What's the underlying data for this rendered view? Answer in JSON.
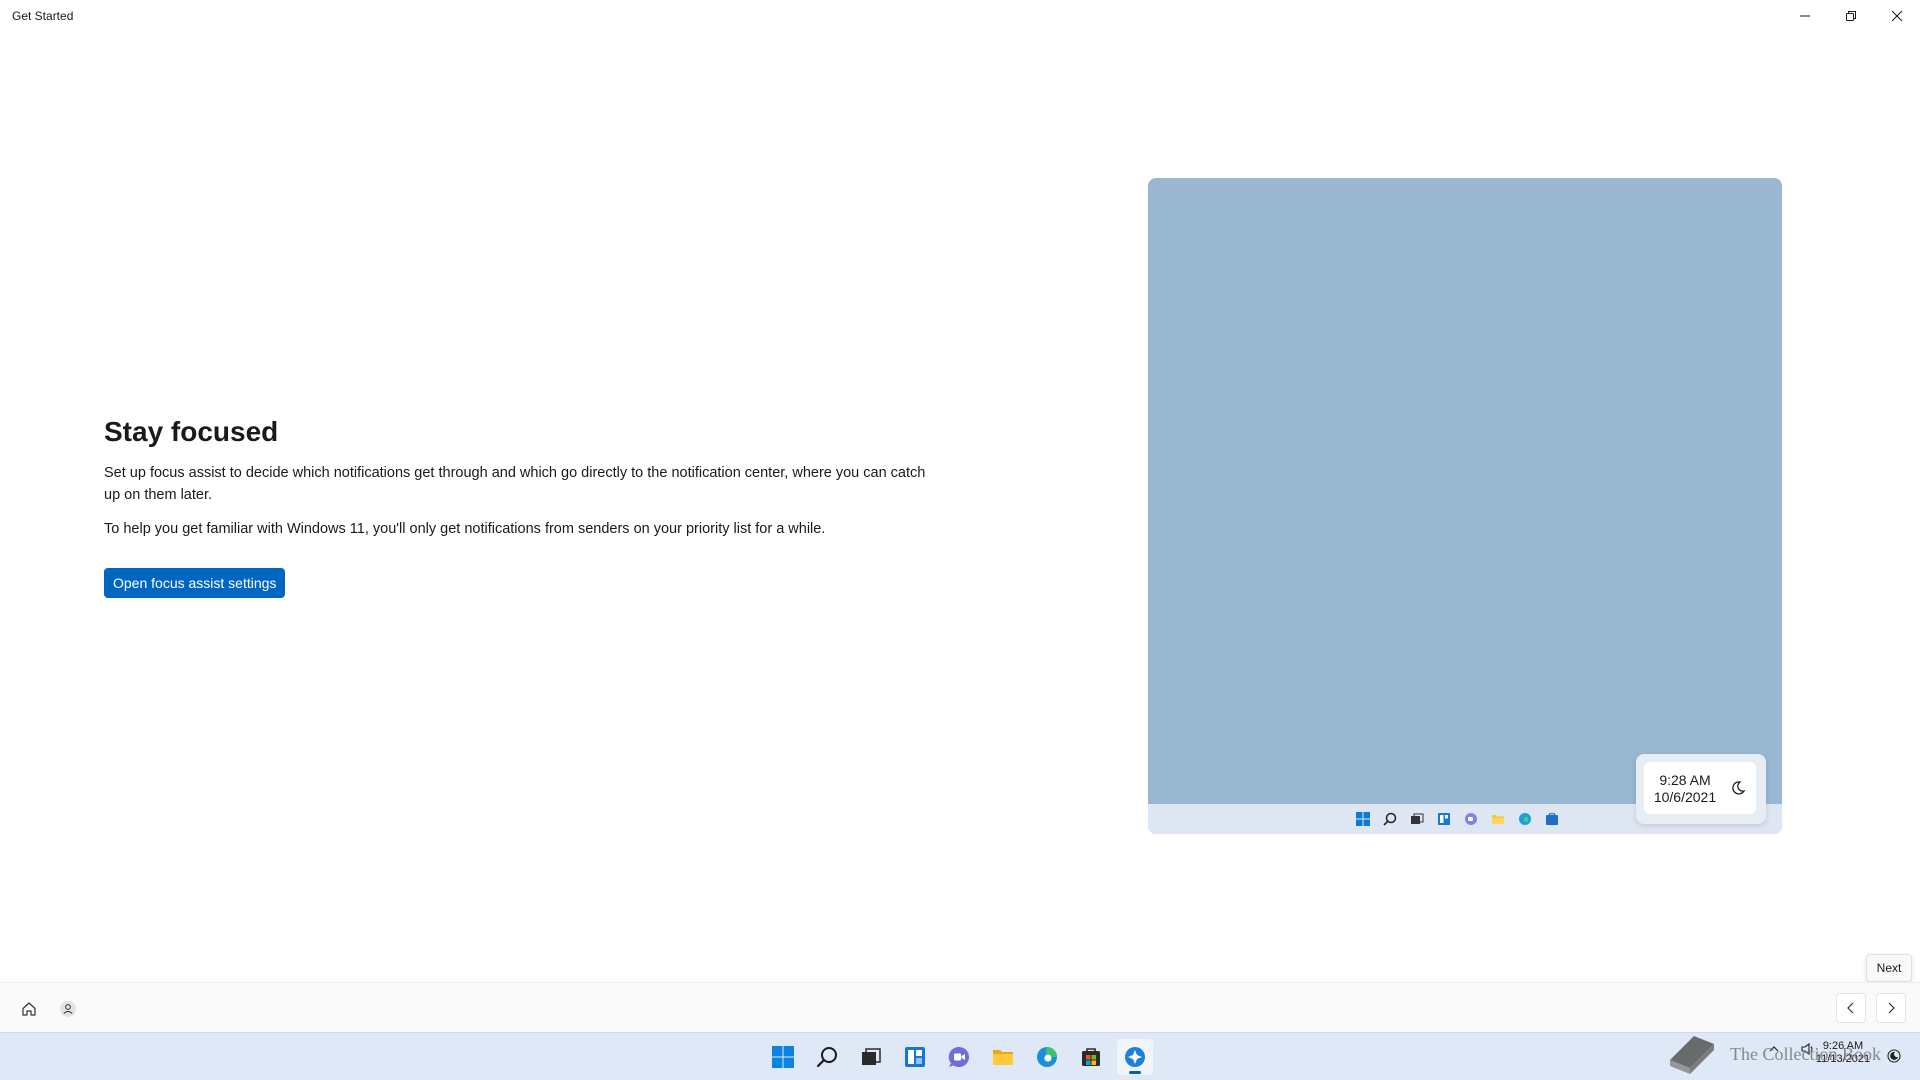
{
  "window": {
    "title": "Get Started",
    "minimize_label": "Minimize",
    "maximize_label": "Restore",
    "close_label": "Close"
  },
  "content": {
    "heading": "Stay focused",
    "description_1": "Set up focus assist to decide which notifications get through and which go directly to the notification center, where you can catch up on them later.",
    "description_2": "To help you get familiar with Windows 11, you'll only get notifications from senders on your priority list for a while.",
    "primary_button": "Open focus assist settings"
  },
  "illustration": {
    "clock_time": "9:28 AM",
    "clock_date": "10/6/2021",
    "taskbar_icons": [
      "windows-icon",
      "search-icon",
      "task-view-icon",
      "widgets-icon",
      "chat-icon",
      "file-explorer-icon",
      "edge-icon",
      "store-icon"
    ]
  },
  "tooltip": {
    "text": "Next"
  },
  "appbar": {
    "home_icon": "home-icon",
    "account_icon": "account-icon",
    "back_icon": "chevron-left-icon",
    "next_icon": "chevron-right-icon"
  },
  "taskbar": {
    "icons": [
      "windows-start-icon",
      "search-icon",
      "task-view-icon",
      "widgets-icon",
      "teams-chat-icon",
      "file-explorer-icon",
      "edge-icon",
      "microsoft-store-icon",
      "get-started-icon"
    ],
    "active_icon": "get-started-icon",
    "clock_time": "9:26 AM",
    "clock_date": "11/13/2021"
  },
  "watermark": {
    "text": "The Collection Book"
  },
  "colors": {
    "accent": "#0067c0",
    "illustration_bg": "#99b7d1",
    "taskbar_bg": "#dfe8f6"
  }
}
